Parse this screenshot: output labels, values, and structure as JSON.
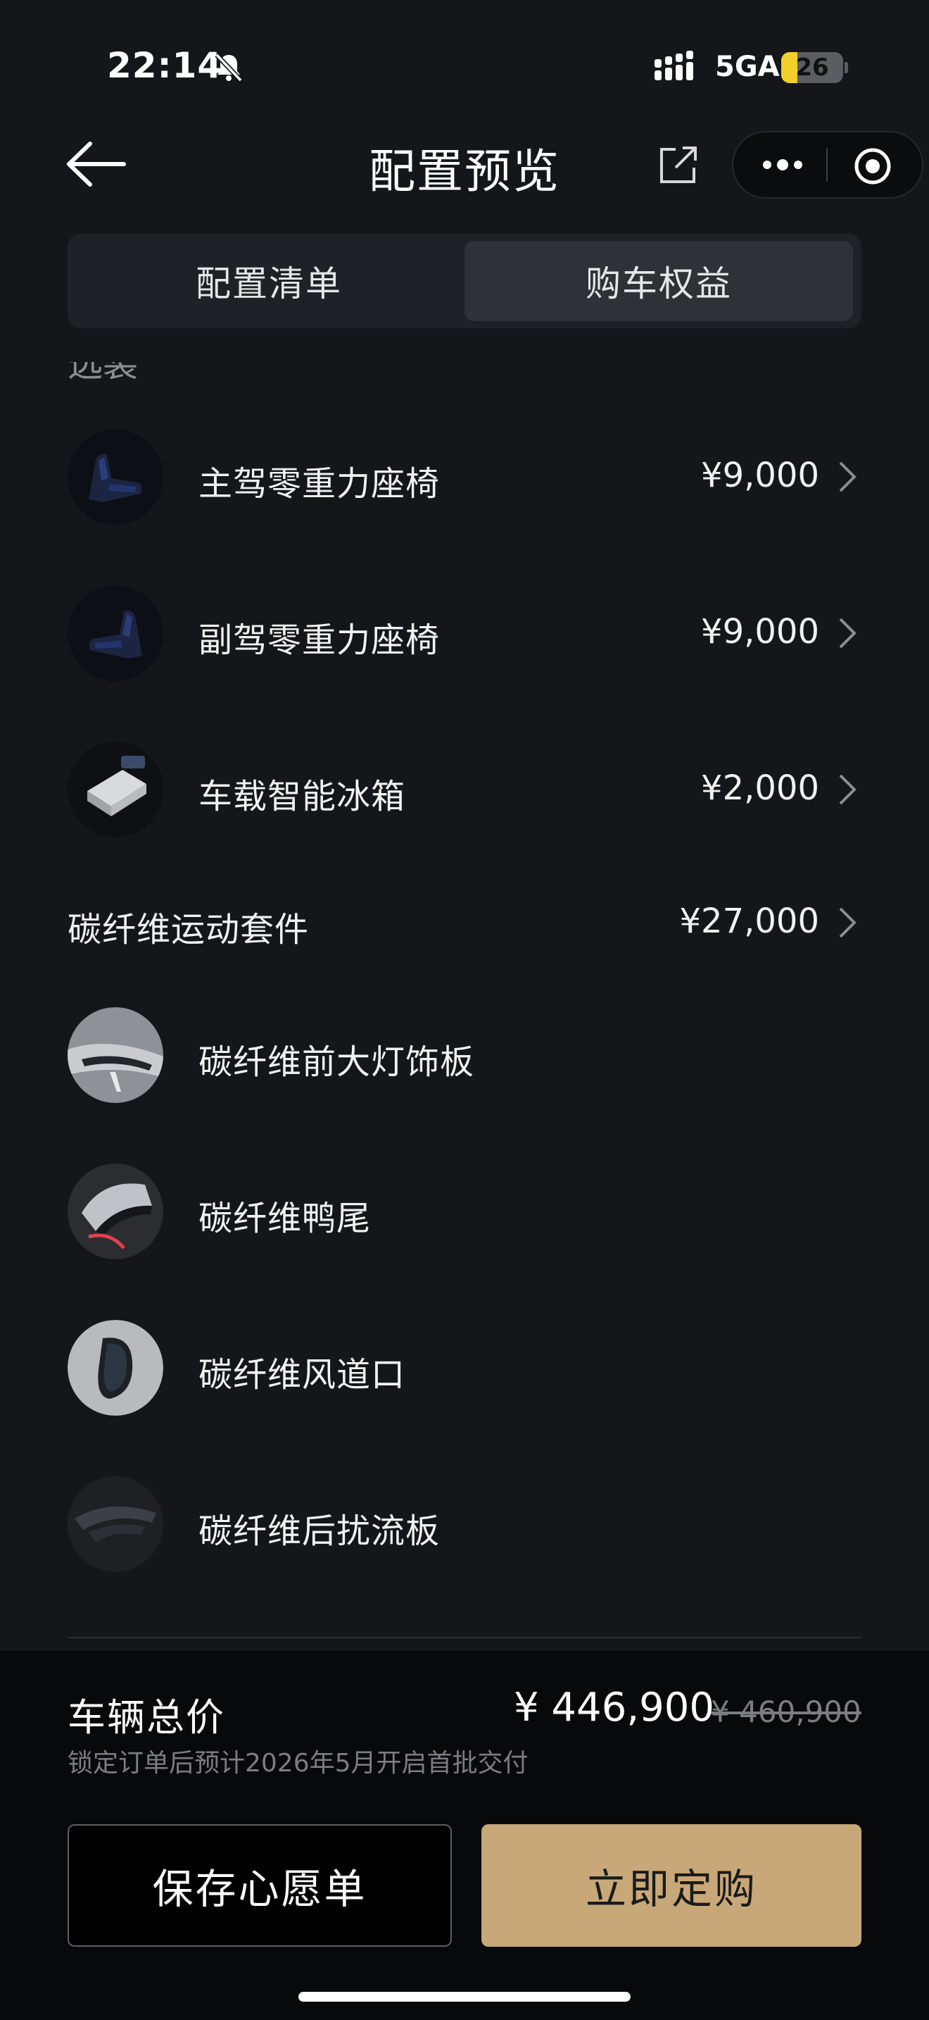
{
  "status_bar": {
    "time": "22:14",
    "network": "5GA",
    "battery_level": "26",
    "battery_fraction": 0.26,
    "battery_color": "#f2cf2a"
  },
  "nav": {
    "title": "配置预览",
    "icons": [
      "arrow-left-icon",
      "share-icon",
      "more-dots-icon",
      "close-circle-icon"
    ]
  },
  "tabs": [
    {
      "label": "配置清单",
      "active": false
    },
    {
      "label": "购车权益",
      "active": true
    }
  ],
  "list": {
    "cut_off_label": "选装",
    "items": [
      {
        "name": "主驾零重力座椅",
        "price": "¥9,000",
        "thumb": "seat"
      },
      {
        "name": "副驾零重力座椅",
        "price": "¥9,000",
        "thumb": "seat"
      },
      {
        "name": "车载智能冰箱",
        "price": "¥2,000",
        "thumb": "fridge"
      }
    ],
    "group": {
      "name": "碳纤维运动套件",
      "price": "¥27,000",
      "items": [
        {
          "name": "碳纤维前大灯饰板",
          "thumb": "headlight"
        },
        {
          "name": "碳纤维鸭尾",
          "thumb": "ducktail"
        },
        {
          "name": "碳纤维风道口",
          "thumb": "vent"
        },
        {
          "name": "碳纤维后扰流板",
          "thumb": "spoiler"
        }
      ]
    }
  },
  "summary": {
    "total_label": "车辆总价",
    "total_price": "¥ 446,900",
    "original_price": "¥ 460,900",
    "delivery_note": "锁定订单后预计2026年5月开启首批交付"
  },
  "actions": {
    "wishlist_label": "保存心愿单",
    "order_label": "立即定购",
    "order_color": "#c8a878"
  }
}
